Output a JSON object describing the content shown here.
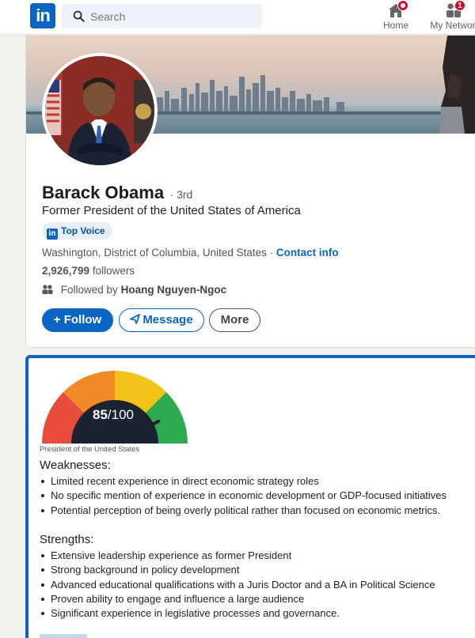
{
  "nav": {
    "search_placeholder": "Search",
    "home_label": "Home",
    "network_label": "My Network",
    "network_badge": "1",
    "logo_text": "in"
  },
  "profile": {
    "name": "Barack Obama",
    "degree": "· 3rd",
    "headline": "Former President of the United States of America",
    "top_voice": "Top Voice",
    "location": "Washington, District of Columbia, United States",
    "separator": " · ",
    "contact_info": "Contact info",
    "followers_count": "2,926,799",
    "followers_label": "followers",
    "followed_prefix": "Followed by",
    "followed_by": "Hoang Nguyen-Ngoc",
    "follow_label": "Follow",
    "message_label": "Message",
    "more_label": "More"
  },
  "assessment": {
    "score": "85",
    "score_max": "/100",
    "score_value": 85,
    "gauge_caption": "President of the United States",
    "weaknesses_title": "Weaknesses:",
    "weaknesses": [
      "Limited recent experience in direct economic strategy roles",
      "No specific mention of experience in economic development or GDP-focused initiatives",
      "Potential perception of being overly political rather than focused on economic metrics."
    ],
    "strengths_title": "Strengths:",
    "strengths": [
      "Extensive leadership experience as former President",
      "Strong background in policy development",
      "Advanced educational qualifications with a Juris Doctor and a BA in Political Science",
      "Proven ability to engage and influence a large audience",
      "Significant experience in legislative processes and governance."
    ]
  },
  "colors": {
    "brand_blue": "#0a66c2",
    "card_border": "#1262c4",
    "gauge_red": "#e84c3d",
    "gauge_orange": "#f08a24",
    "gauge_yellow": "#f2c318",
    "gauge_green": "#2eaa4f"
  }
}
